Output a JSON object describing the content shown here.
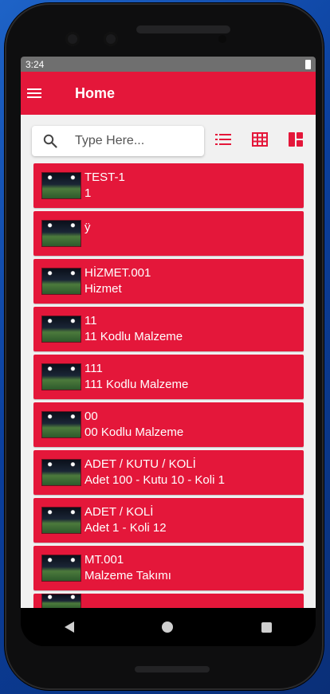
{
  "status": {
    "time": "3:24"
  },
  "appbar": {
    "title": "Home",
    "menu_icon": "menu-icon"
  },
  "search": {
    "placeholder": "Type Here...",
    "value": ""
  },
  "view_toggles": [
    "list-view-icon",
    "grid-view-icon",
    "tile-view-icon"
  ],
  "colors": {
    "accent": "#e4173a",
    "background": "#f1f1f1"
  },
  "items": [
    {
      "code": "TEST-1",
      "name": "1"
    },
    {
      "code": "ÿ",
      "name": ""
    },
    {
      "code": "HİZMET.001",
      "name": "Hizmet"
    },
    {
      "code": "11",
      "name": "11 Kodlu Malzeme"
    },
    {
      "code": "111",
      "name": "111 Kodlu Malzeme"
    },
    {
      "code": "00",
      "name": "00 Kodlu Malzeme"
    },
    {
      "code": "ADET / KUTU / KOLİ",
      "name": "Adet 100 - Kutu 10 - Koli 1"
    },
    {
      "code": "ADET / KOLİ",
      "name": "Adet 1 - Koli 12"
    },
    {
      "code": "MT.001",
      "name": "Malzeme Takımı"
    }
  ],
  "navbar": [
    "back-icon",
    "home-icon",
    "recent-apps-icon"
  ]
}
